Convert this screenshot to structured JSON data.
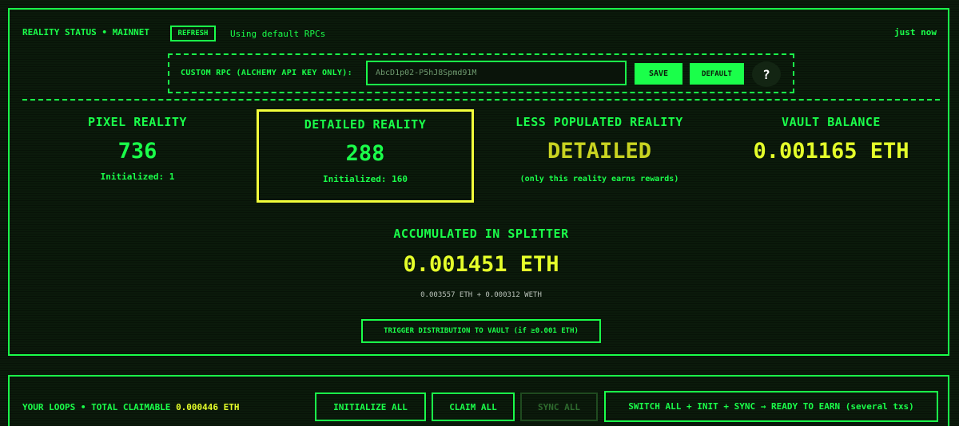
{
  "header": {
    "status_title": "REALITY STATUS • MAINNET",
    "refresh_label": "REFRESH",
    "rpc_note": "Using default RPCs",
    "time": "just now"
  },
  "rpc": {
    "label": "CUSTOM RPC (ALCHEMY API KEY ONLY):",
    "value": "AbcD1p02-P5hJ8Spmd91M",
    "save_label": "SAVE",
    "default_label": "DEFAULT",
    "help_label": "?"
  },
  "stats": {
    "pixel": {
      "title": "PIXEL REALITY",
      "value": "736",
      "sub": "Initialized: 1"
    },
    "detailed": {
      "title": "DETAILED REALITY",
      "value": "288",
      "sub": "Initialized: 160"
    },
    "less_populated": {
      "title": "LESS POPULATED REALITY",
      "value": "DETAILED",
      "sub": "(only this reality earns rewards)"
    },
    "vault": {
      "title": "VAULT BALANCE",
      "value": "0.001165 ETH"
    }
  },
  "splitter": {
    "title": "ACCUMULATED IN SPLITTER",
    "value": "0.001451 ETH",
    "breakdown": "0.003557 ETH + 0.000312 WETH",
    "trigger_label": "TRIGGER DISTRIBUTION TO VAULT (if ≥0.001 ETH)"
  },
  "loops": {
    "title_prefix": "YOUR LOOPS • TOTAL CLAIMABLE",
    "claimable": "0.000446 ETH",
    "initialize_label": "INITIALIZE ALL",
    "claim_label": "CLAIM ALL",
    "sync_label": "SYNC ALL",
    "switch_label": "SWITCH ALL + INIT + SYNC → READY TO EARN (several txs)"
  },
  "colors": {
    "accent": "#1aff4a",
    "highlight": "#e5ff2a",
    "background": "#0b1a0b"
  }
}
